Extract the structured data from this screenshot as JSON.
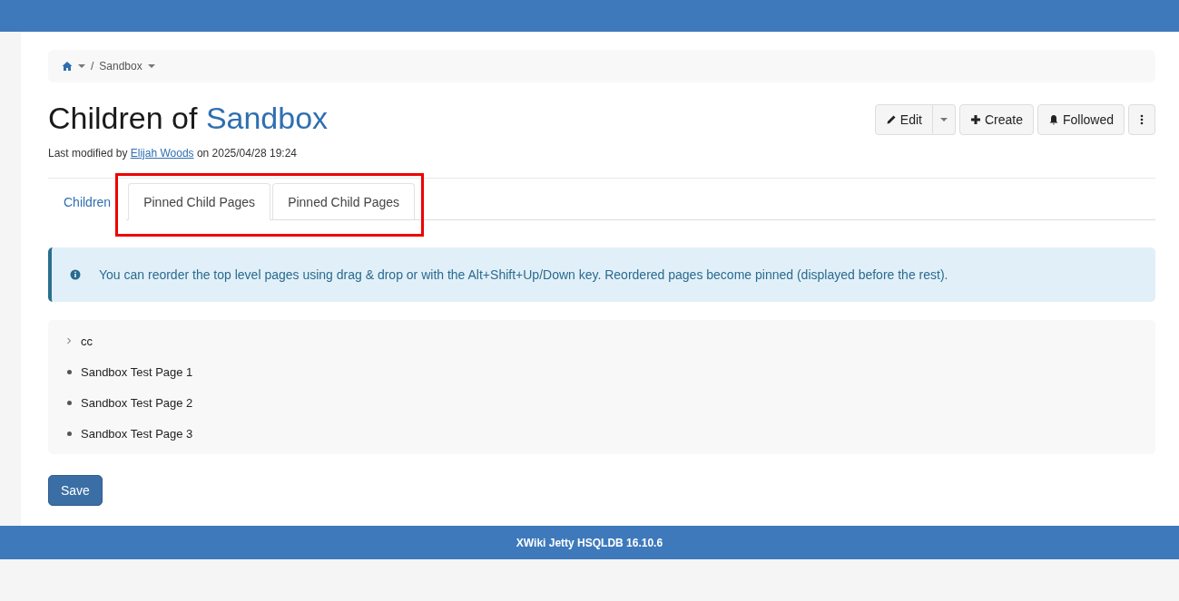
{
  "breadcrumb": {
    "items": [
      {
        "kind": "home"
      },
      {
        "kind": "page",
        "separator": "/",
        "label": "Sandbox"
      }
    ]
  },
  "title": {
    "prefix": "Children of",
    "page": "Sandbox"
  },
  "meta": {
    "prefix": "Last modified by",
    "author": "Elijah Woods",
    "suffix": "on 2025/04/28 19:24"
  },
  "actions": [
    {
      "kind": "edit",
      "label": "Edit"
    },
    {
      "kind": "create",
      "label": "Create"
    },
    {
      "kind": "followed",
      "label": "Followed"
    },
    {
      "kind": "more"
    }
  ],
  "tabs": [
    {
      "label": "Children",
      "selected": false,
      "highlighted": false
    },
    {
      "label": "Pinned Child Pages",
      "selected": true,
      "highlighted": true
    },
    {
      "label": "Pinned Child Pages",
      "selected": false,
      "highlighted": true
    }
  ],
  "info": "You can reorder the top level pages using drag & drop or with the Alt+Shift+Up/Down key. Reordered pages become pinned (displayed before the rest).",
  "tree": [
    {
      "label": "cc",
      "kind": "expandable",
      "expanded": false
    },
    {
      "label": "Sandbox Test Page 1",
      "kind": "leaf"
    },
    {
      "label": "Sandbox Test Page 2",
      "kind": "leaf"
    },
    {
      "label": "Sandbox Test Page 3",
      "kind": "leaf"
    }
  ],
  "save_button": "Save",
  "footer": "XWiki Jetty HSQLDB 16.10.6"
}
